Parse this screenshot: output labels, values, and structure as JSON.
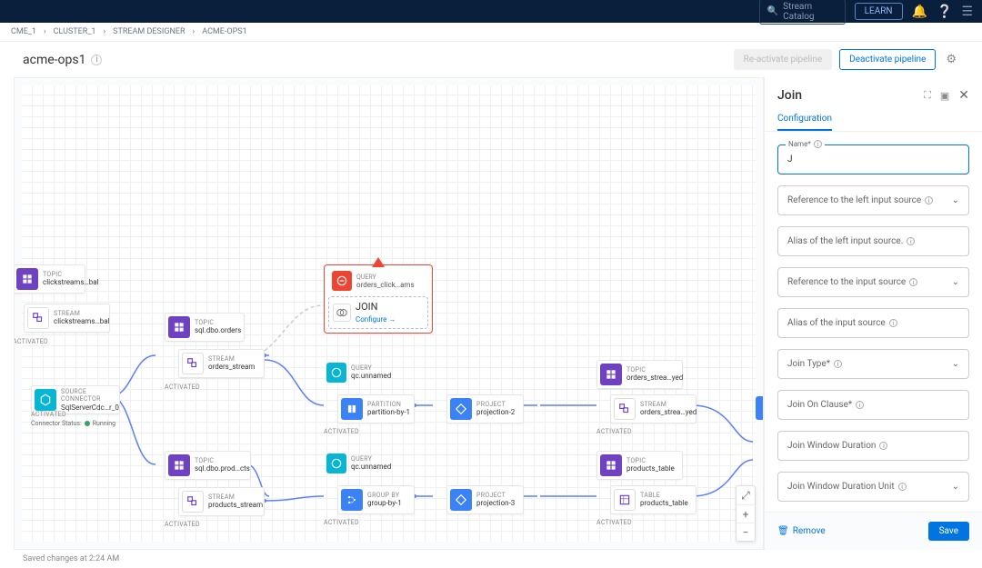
{
  "topbar": {
    "search_placeholder": "Stream Catalog",
    "learn": "LEARN"
  },
  "breadcrumb": {
    "items": [
      "CME_1",
      "CLUSTER_1",
      "STREAM DESIGNER",
      "ACME-OPS1"
    ]
  },
  "header": {
    "title": "acme-ops1",
    "reactivate": "Re-activate pipeline",
    "deactivate": "Deactivate pipeline"
  },
  "footer": {
    "text": "Saved changes at 2:24 AM"
  },
  "nodes": {
    "topic1": {
      "lbl": "TOPIC",
      "nm": "clickstreams…bal"
    },
    "stream1": {
      "lbl": "STREAM",
      "nm": "clickstreams…bal"
    },
    "activated": "ACTIVATED",
    "source": {
      "lbl": "SOURCE CONNECTOR",
      "nm": "SqlServerCdc…r_0"
    },
    "status": {
      "label": "Connector Status:",
      "state": "Running"
    },
    "topic2": {
      "lbl": "TOPIC",
      "nm": "sql.dbo.orders"
    },
    "stream2": {
      "lbl": "STREAM",
      "nm": "orders_stream"
    },
    "topic3": {
      "lbl": "TOPIC",
      "nm": "sql.dbo.prod…cts"
    },
    "stream3": {
      "lbl": "STREAM",
      "nm": "products_stream"
    },
    "error": {
      "lbl": "QUERY",
      "nm": "orders_click…ams",
      "subLbl": "JOIN",
      "configure": "Configure →"
    },
    "query1": {
      "lbl": "QUERY",
      "nm": "qc.unnamed"
    },
    "part": {
      "lbl": "PARTITION",
      "nm": "partition-by-1"
    },
    "proj2": {
      "lbl": "PROJECT",
      "nm": "projection-2"
    },
    "query2": {
      "lbl": "QUERY",
      "nm": "qc.unnamed"
    },
    "group": {
      "lbl": "GROUP BY",
      "nm": "group-by-1"
    },
    "proj3": {
      "lbl": "PROJECT",
      "nm": "projection-3"
    },
    "topic4": {
      "lbl": "TOPIC",
      "nm": "orders_strea…yed"
    },
    "stream4": {
      "lbl": "STREAM",
      "nm": "orders_strea…yed"
    },
    "topic5": {
      "lbl": "TOPIC",
      "nm": "products_table"
    },
    "table1": {
      "lbl": "TABLE",
      "nm": "products_table"
    }
  },
  "sidepanel": {
    "title": "Join",
    "tab": "Configuration",
    "fields": {
      "name": {
        "label": "Name*",
        "value": "J"
      },
      "leftRef": "Reference to the left input source",
      "leftAlias": "Alias of the left input source.",
      "ref": "Reference to the input source",
      "alias": "Alias of the input source",
      "joinType": "Join Type*",
      "joinOn": "Join On Clause*",
      "dur": "Join Window Duration",
      "durUnit": "Join Window Duration Unit"
    },
    "remove": "Remove",
    "save": "Save"
  }
}
